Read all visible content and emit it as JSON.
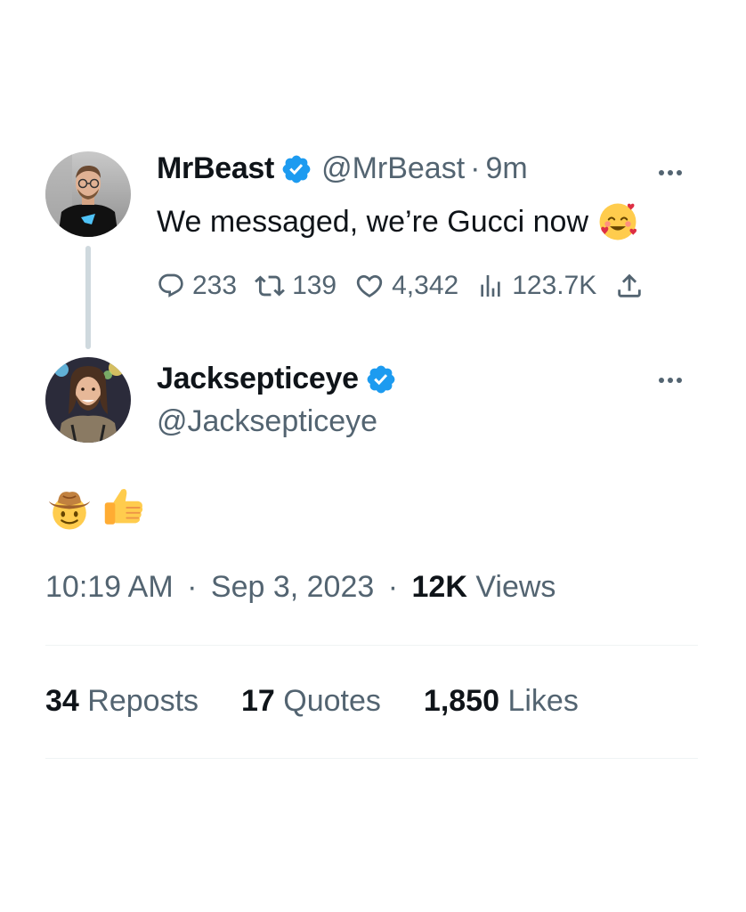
{
  "parent_tweet": {
    "author": {
      "display_name": "MrBeast",
      "handle": "@MrBeast",
      "verified": true,
      "avatar_icon": "avatar-mrbeast"
    },
    "time_ago": "9m",
    "separator": "·",
    "text": "We messaged, we’re Gucci now",
    "text_emoji": "smiling-face-with-hearts",
    "metrics": {
      "replies": "233",
      "reposts": "139",
      "likes": "4,342",
      "views": "123.7K"
    }
  },
  "reply_tweet": {
    "author": {
      "display_name": "Jacksepticeye",
      "handle": "@Jacksepticeye",
      "verified": true,
      "avatar_icon": "avatar-jacksepticeye"
    },
    "emojis": [
      "cowboy-hat-face",
      "thumbs-up"
    ],
    "time": "10:19 AM",
    "date": "Sep 3, 2023",
    "separator": "·",
    "views_count": "12K",
    "views_label": "Views"
  },
  "engagement": {
    "reposts_count": "34",
    "reposts_label": "Reposts",
    "quotes_count": "17",
    "quotes_label": "Quotes",
    "likes_count": "1,850",
    "likes_label": "Likes"
  },
  "colors": {
    "text_primary": "#0f1419",
    "text_secondary": "#536471",
    "verified_blue": "#1d9bf0",
    "thread_line": "#cfd9de",
    "divider": "#eff3f4"
  }
}
